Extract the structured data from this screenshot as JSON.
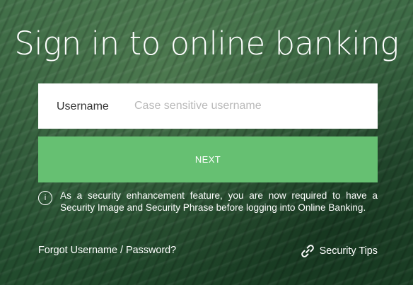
{
  "page": {
    "title": "Sign in to online banking"
  },
  "login": {
    "username_label": "Username",
    "username_placeholder": "Case sensitive username",
    "username_value": "",
    "next_label": "NEXT"
  },
  "notice": {
    "icon": "info-icon",
    "icon_glyph": "i",
    "text": "As a security enhancement feature, you are now required to have a Security Image and Security Phrase before logging into Online Banking."
  },
  "footer": {
    "forgot_label": "Forgot Username / Password?",
    "security_tips_label": "Security Tips",
    "security_tips_icon": "link-icon"
  },
  "colors": {
    "next_button": "#66c072",
    "background": "#2f5a3a",
    "input_bg": "#ffffff",
    "placeholder": "#b9b9b9"
  }
}
